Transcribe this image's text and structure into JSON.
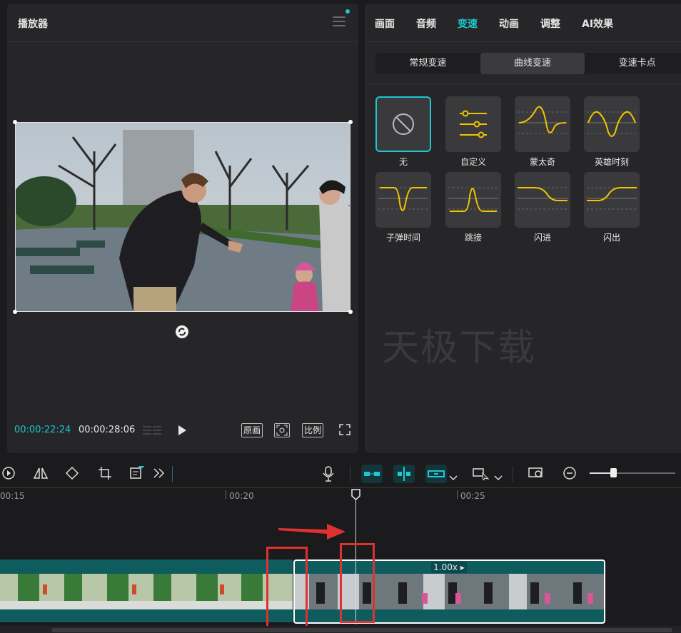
{
  "player": {
    "title": "播放器",
    "current_time": "00:00:22:24",
    "total_time": "00:00:28:06",
    "btn_original": "原画",
    "btn_ratio": "比例"
  },
  "speed_panel": {
    "tabs": [
      "画面",
      "音频",
      "变速",
      "动画",
      "调整",
      "AI效果"
    ],
    "active_tab": "变速",
    "modes": [
      "常规变速",
      "曲线变速",
      "变速卡点"
    ],
    "active_mode": "曲线变速",
    "presets": [
      "无",
      "自定义",
      "蒙太奇",
      "英雄时刻",
      "子弹时间",
      "跳接",
      "闪进",
      "闪出"
    ],
    "selected_preset": "无",
    "watermark": "天极下载"
  },
  "timeline": {
    "ruler_labels": [
      "00:15",
      "00:20",
      "00:25"
    ],
    "clip_speed": "1.00x"
  },
  "colors": {
    "accent": "#1ec7d1",
    "curve": "#f0c400",
    "highlight": "#e03131",
    "clip": "#0e5c5e"
  }
}
